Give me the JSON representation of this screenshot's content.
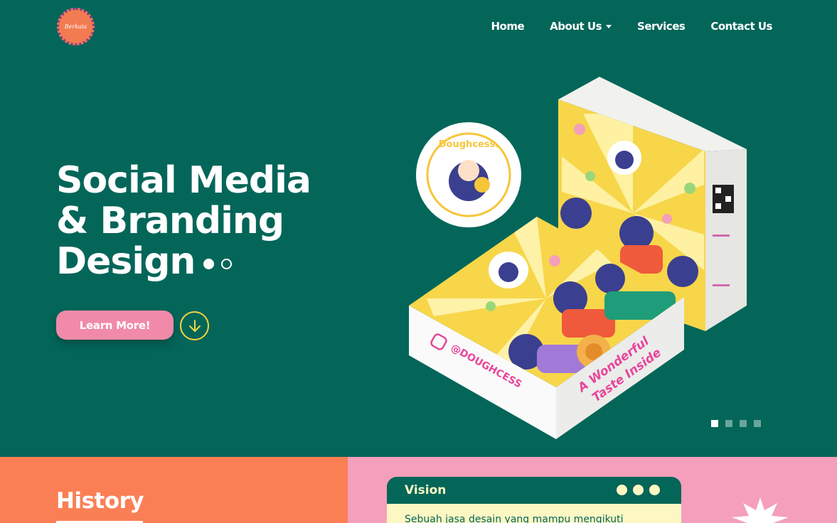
{
  "brand": {
    "logo_text": "Berkaia"
  },
  "nav": {
    "items": [
      {
        "label": "Home"
      },
      {
        "label": "About Us"
      },
      {
        "label": "Services"
      },
      {
        "label": "Contact Us"
      }
    ]
  },
  "hero": {
    "title_lines": [
      "Social Media",
      "& Branding",
      "Design"
    ],
    "cta_label": "Learn More!"
  },
  "product": {
    "brand": "Doughcess.",
    "instagram": "@DOUGHCESS",
    "tagline_line1": "A Wonderful",
    "tagline_line2": "Taste Inside"
  },
  "slider": {
    "count": 4,
    "active": 0
  },
  "history": {
    "title": "History"
  },
  "vision": {
    "title": "Vision",
    "text": "Sebuah jasa desain yang mampu mengikuti"
  },
  "colors": {
    "primary": "#036659",
    "orange": "#fa7f55",
    "pink": "#f49fbb",
    "button_pink": "#f08aa8",
    "cream": "#fdf7c3",
    "yellow": "#f6d33f"
  }
}
